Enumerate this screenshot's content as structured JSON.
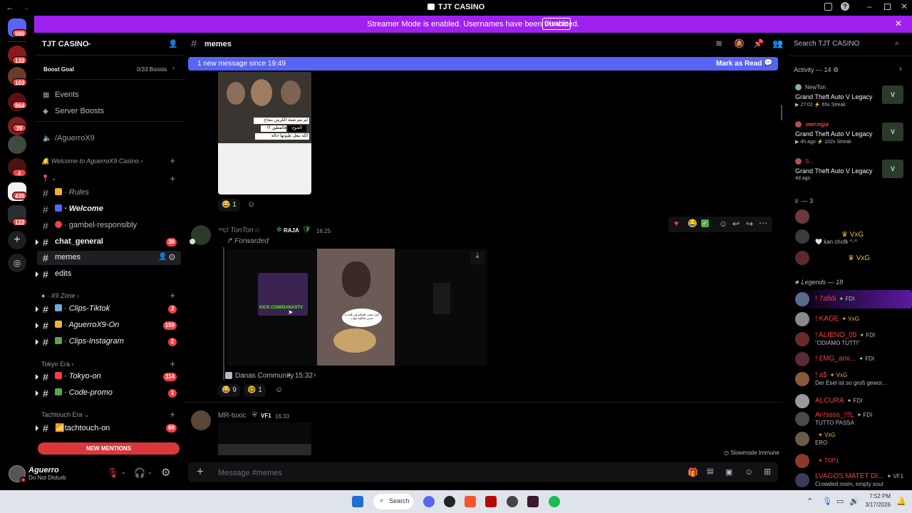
{
  "window": {
    "title": "TJT CASINO"
  },
  "banner": {
    "text": "Streamer Mode is enabled. Usernames have been truncated.",
    "button": "Disable"
  },
  "rail": {
    "badges": [
      "980",
      "133",
      "103",
      "864",
      "39",
      "4",
      "435",
      "122"
    ]
  },
  "server": {
    "name": "TJT CASINO",
    "boost_goal": "Boost Goal",
    "boost_count": "0/33 Boosts"
  },
  "sidebar": {
    "events": "Events",
    "server_boosts": "Server Boosts",
    "agueros": "/AguerroX9",
    "cat_welcome": "Welcome to AguerroX9 Casino",
    "channels": [
      {
        "label": "Rules",
        "badge": ""
      },
      {
        "label": "Welcome",
        "badge": ""
      },
      {
        "label": "gambel-responsibly",
        "badge": ""
      },
      {
        "label": "chat_general",
        "badge": "39"
      },
      {
        "label": "memes",
        "badge": ""
      },
      {
        "label": "edits",
        "badge": ""
      }
    ],
    "cat_x9": "X9 Zone",
    "x9_channels": [
      {
        "label": "Clips-Tiktok",
        "badge": "3"
      },
      {
        "label": "AguerroX9-On",
        "badge": "159"
      },
      {
        "label": "Clips-Instagram",
        "badge": "2"
      }
    ],
    "cat_tokyo": "Tokyo Era",
    "tokyo_channels": [
      {
        "label": "Tokyo-on",
        "badge": "114"
      },
      {
        "label": "Code-promo",
        "badge": "1"
      }
    ],
    "cat_tachtouch": "Tachtouch Era",
    "tach_channels": [
      {
        "label": "tachtouch-on",
        "badge": "69"
      }
    ],
    "new_mentions": "NEW MENTIONS"
  },
  "user": {
    "name": "Aguerro",
    "status": "Do Not Disturb"
  },
  "header": {
    "channel": "memes",
    "search": "Search TJT CASINO"
  },
  "newbar": {
    "text": "1 new message since 19:49",
    "action": "Mark as Read"
  },
  "messages": [
    {
      "reactions": [
        {
          "emoji": "😂",
          "count": "1"
        }
      ]
    },
    {
      "author": "ᵛᵛcl TonTon☆",
      "tag": "RAJA",
      "time": "16:25",
      "forwarded": "Forwarded",
      "source": "Danas Community",
      "source_time": "15:32",
      "reactions": [
        {
          "emoji": "😂",
          "count": "9"
        },
        {
          "emoji": "🤓",
          "count": "1"
        }
      ],
      "caption_ar": "كيف صعب التحكم في كلمة يا جدتي شاكيلة أبواب"
    },
    {
      "author": "MR-toxic",
      "tag": "VF1",
      "time": "16:33"
    }
  ],
  "meme_caption_ar": [
    "لم تتم تعبئة الكرش بنجاح",
    "الجوع",
    "!!! فالفطور",
    "الله ينعل طبونها حالة"
  ],
  "image_text": "KICK.COM/DANASTV",
  "slowmode": "Slowmode Immune",
  "composer": {
    "placeholder": "Message #memes"
  },
  "activity": {
    "header": "Activity — 14",
    "items": [
      {
        "user": "NewTon",
        "game": "Grand Theft Auto V Legacy",
        "meta": "27:02",
        "streak": "65x Streak"
      },
      {
        "user": "𝒎𝒆𝒓𝒏𝒊𝒈𝒂",
        "game": "Grand Theft Auto V Legacy",
        "meta": "4h ago",
        "streak": "102x Streak"
      },
      {
        "user": "S...",
        "game": "Grand Theft Auto V Legacy",
        "meta": "4d ago",
        "streak": ""
      }
    ]
  },
  "group_3": {
    "header": "— 3",
    "members": [
      {
        "name": "",
        "role": ""
      },
      {
        "name": "",
        "role": "VxG",
        "sub": "kan chofk ^-^"
      },
      {
        "name": "",
        "role": "VxG"
      }
    ]
  },
  "legends": {
    "header": "Legends — 18",
    "members": [
      {
        "name": "! 7afidi",
        "role": "FDI",
        "sub": ""
      },
      {
        "name": "! KAGE",
        "role": "VxG",
        "sub": ""
      },
      {
        "name": "! ALIENO_05",
        "role": "FDI",
        "sub": "\"ODIAMO TUTTI\""
      },
      {
        "name": "! £MG_ami...",
        "role": "FDI",
        "sub": ""
      },
      {
        "name": "! a$",
        "role": "VxG",
        "sub": "Der Esel ist so groß gewor..."
      },
      {
        "name": "ALCURA",
        "role": "FDI",
        "sub": ""
      },
      {
        "name": "An!ssss_!!!L",
        "role": "FDI",
        "sub": "TUTTO PASSA"
      },
      {
        "name": "",
        "role": "VxG",
        "sub": "ERO"
      },
      {
        "name": "",
        "role": "TOP1",
        "sub": ""
      },
      {
        "name": "LVAGOS MATET DI...",
        "role": "VF1",
        "sub": "Crowded room, empty soul"
      }
    ]
  },
  "taskbar": {
    "search": "Search",
    "time": "7:52 PM",
    "date": "3/17/2026"
  },
  "colors": {
    "accent": "#5865f2",
    "banner": "#a020f0",
    "mention": "#f23f43",
    "bg": "#000000"
  }
}
